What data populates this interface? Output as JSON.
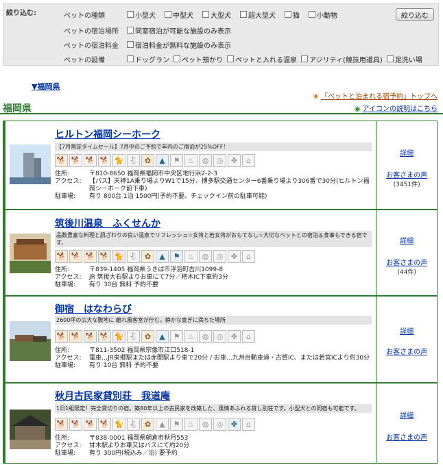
{
  "filter": {
    "title": "絞り込む:",
    "rows": [
      {
        "label": "ペットの種類",
        "options": [
          "小型犬",
          "中型犬",
          "大型犬",
          "超大型犬",
          "猫",
          "小動物"
        ]
      },
      {
        "label": "ペットの宿泊場所",
        "options": [
          "同室宿泊が可能な施設のみ表示"
        ]
      },
      {
        "label": "ペットの宿泊料金",
        "options": [
          "宿泊料金が無料な施設のみ表示"
        ]
      },
      {
        "label": "ペットの設備",
        "options": [
          "ドッグラン",
          "ペット預かり",
          "ペットと入れる温泉",
          "アジリティ(競技用道具)",
          "足洗い場"
        ]
      }
    ],
    "button": "絞り込む"
  },
  "anchor_link": "▼福岡県",
  "top_link": "「ペットと泊まれる宿予約」トップへ",
  "icon_help_link": "アイコンの説明はこちら",
  "prefecture": "福岡県",
  "listings": [
    {
      "name": "ヒルトン福岡シーホーク",
      "catch": "【7月限定タイムセール】7月中のご予約で年内のご宿泊が25%OFF！",
      "address_label": "住所:",
      "address": "〒810-8650 福岡県福岡市中央区地行浜2-2-3",
      "access_label": "アクセス:",
      "access": "【バス】天神1A乗り場よりW1で15分、博多駅交通センター6番乗り場より306番で30分(ヒルトン福岡シーホーク前下車)",
      "parking_label": "駐車場:",
      "parking": "有り 800台 1泊 1500円(予約不要。チェックイン前の駐車可能)",
      "detail": "詳細",
      "voice": "お客さまの声",
      "count": "(3451件)"
    },
    {
      "name": "筑後川温泉　ふくせんか",
      "catch": "品数豊富な料理と肌ざわりの良い温泉でリフレッシュ☆女将と若女将がおもてなし☆大切なペットとの宿泊＆食事もできる宿です。",
      "address_label": "住所:",
      "address": "〒839-1405 福岡県うきは市浮羽町古川1099-8",
      "access_label": "アクセス:",
      "access": "JR 筑後大石駅よりお車にて7分／杷木IC下車約3分",
      "parking_label": "駐車場:",
      "parking": "有り 30台 無料 予約不要",
      "detail": "詳細",
      "voice": "お客さまの声",
      "count": "(44件)"
    },
    {
      "name": "御宿　はなわらび",
      "catch": "2600坪の広大な敷地に 離れ風客室が佇む。静かな寛ぎに満ちた場所",
      "address_label": "住所:",
      "address": "〒811-3502 福岡県宗像市江口518-1",
      "access_label": "アクセス:",
      "access": "電車…JR東郷駅または赤間駅より車で20分 / お車…九州自動車道・古賀IC、または若宮ICより約30分",
      "parking_label": "駐車場:",
      "parking": "有り 10台 無料 予約不要",
      "detail": "詳細",
      "voice": "お客さまの声",
      "count": ""
    },
    {
      "name": "秋月古民家貸別荘　我道庵",
      "catch": "1日1組限定！完全貸切りの宿。築80年以上の古民家を改築した、風情あふれる貸し別荘です。小型犬との同宿も可能です。",
      "address_label": "住所:",
      "address": "〒838-0001 福岡県朝倉市秋月553",
      "access_label": "アクセス:",
      "access": "甘木駅よりお車又はバスにて約20分",
      "parking_label": "駐車場:",
      "parking": "有り 300円(税込み／泊) 要予約",
      "detail": "詳細",
      "voice": "お客さまの声",
      "count": ""
    }
  ],
  "icon_names": [
    "small-dog-icon",
    "medium-dog-icon",
    "large-dog-icon",
    "xl-dog-icon",
    "cat-icon",
    "small-animal-icon",
    "room-stay-icon",
    "pet-fee-icon",
    "dog-run-icon",
    "pet-care-icon",
    "pet-onsen-icon",
    "agility-icon",
    "foot-wash-icon",
    "pet-hotel-icon"
  ],
  "colors": {
    "accent_green": "#2f7a2f",
    "link_blue": "#0033aa",
    "link_orange": "#a04000"
  }
}
